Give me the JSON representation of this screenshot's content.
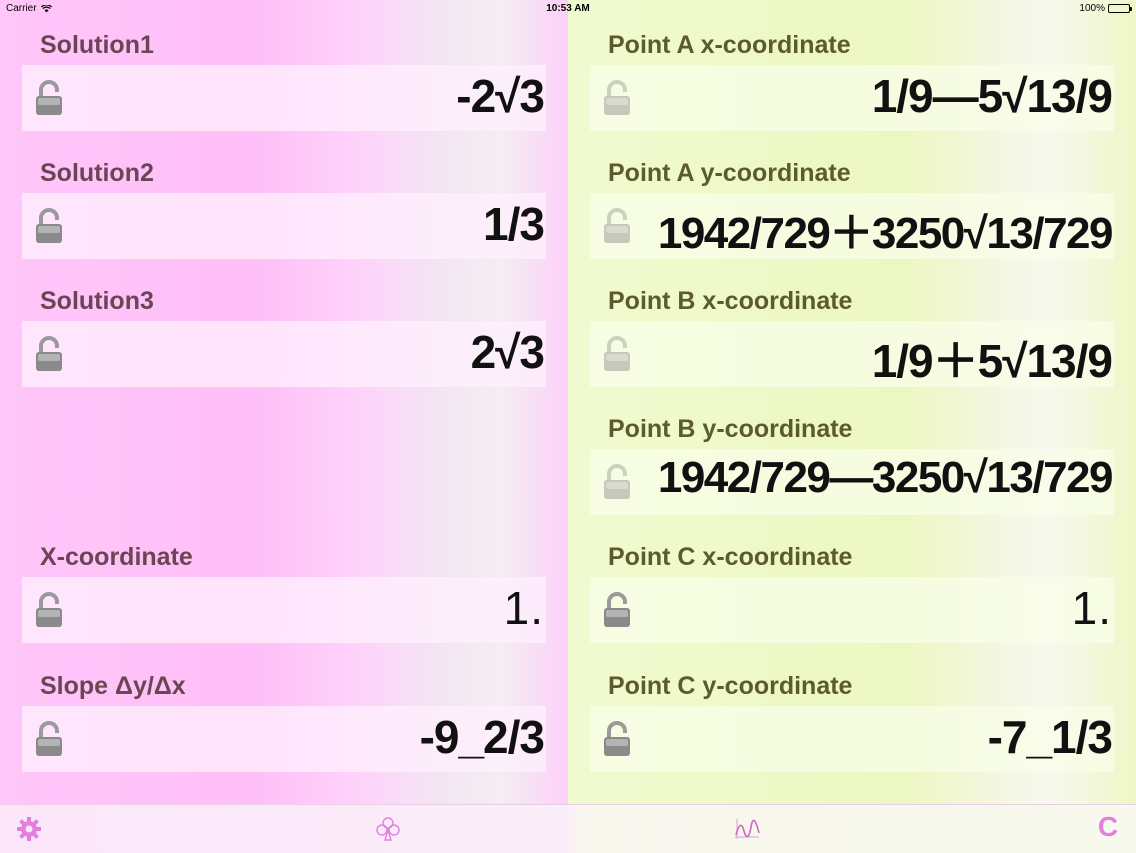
{
  "status": {
    "carrier": "Carrier",
    "time": "10:53 AM",
    "battery": "100%"
  },
  "left_fields": [
    {
      "label": "Solution1",
      "value": "-2√3"
    },
    {
      "label": "Solution2",
      "value": "1/3"
    },
    {
      "label": "Solution3",
      "value": "2√3"
    },
    {
      "label": "X-coordinate",
      "value": "1."
    },
    {
      "label": "Slope Δy/Δx",
      "value": "-9_2/3"
    }
  ],
  "right_fields": [
    {
      "label": "Point A x-coordinate",
      "value": "1/9—5√13/9"
    },
    {
      "label": "Point A y-coordinate",
      "value": "1942/729＋3250√13/729"
    },
    {
      "label": "Point B x-coordinate",
      "value": "1/9＋5√13/9"
    },
    {
      "label": "Point B y-coordinate",
      "value": "1942/729—3250√13/729"
    },
    {
      "label": "Point C x-coordinate",
      "value": "1."
    },
    {
      "label": "Point C y-coordinate",
      "value": "-7_1/3"
    }
  ],
  "toolbar": {
    "clear_label": "C"
  },
  "icons": {
    "lock": "lock-icon",
    "settings": "gear-icon",
    "club": "club-icon",
    "graph": "graph-icon"
  },
  "colors": {
    "left_panel": "#ffc6f9",
    "right_panel": "#eef8c6",
    "left_label": "#6b4553",
    "right_label": "#5c5b2c",
    "toolbar_accent": "#e37fe0"
  }
}
